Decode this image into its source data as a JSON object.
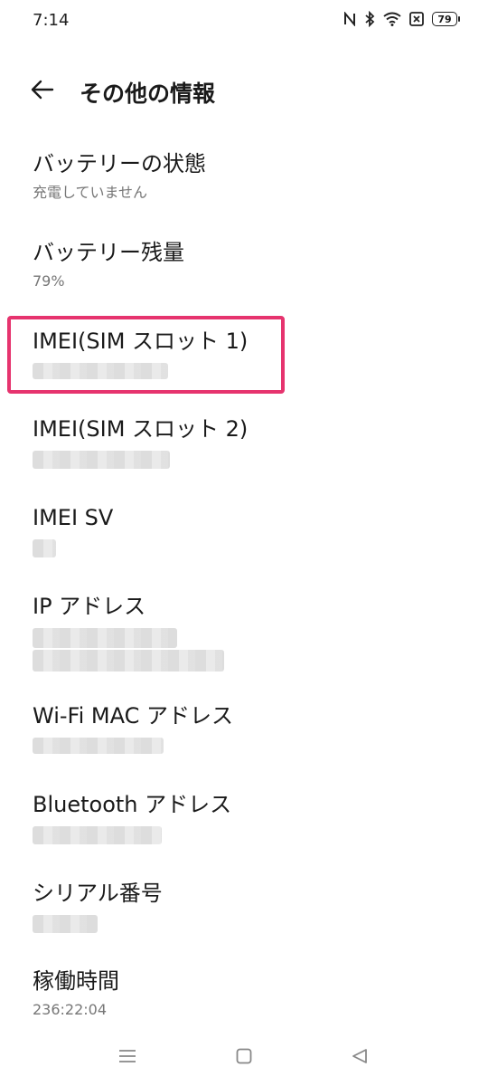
{
  "status_bar": {
    "time": "7:14",
    "battery": "79",
    "icons": [
      "nfc-icon",
      "bluetooth-icon",
      "wifi-icon",
      "no-sim-icon",
      "battery-icon"
    ]
  },
  "header": {
    "title": "その他の情報",
    "back_icon": "arrow-left-icon"
  },
  "items": [
    {
      "title": "バッテリーの状態",
      "value": "充電していません"
    },
    {
      "title": "バッテリー残量",
      "value": "79%"
    },
    {
      "title": "IMEI(SIM スロット 1)",
      "value": ""
    },
    {
      "title": "IMEI(SIM スロット 2)",
      "value": ""
    },
    {
      "title": "IMEI SV",
      "value": ""
    },
    {
      "title": "IP アドレス",
      "value": ""
    },
    {
      "title": "Wi-Fi MAC アドレス",
      "value": ""
    },
    {
      "title": "Bluetooth アドレス",
      "value": ""
    },
    {
      "title": "シリアル番号",
      "value": ""
    },
    {
      "title": "稼働時間",
      "value": "236:22:04"
    }
  ],
  "highlight_color": "#e6336e",
  "nav_bar": {
    "icons": [
      "menu-icon",
      "home-icon",
      "back-triangle-icon"
    ]
  }
}
